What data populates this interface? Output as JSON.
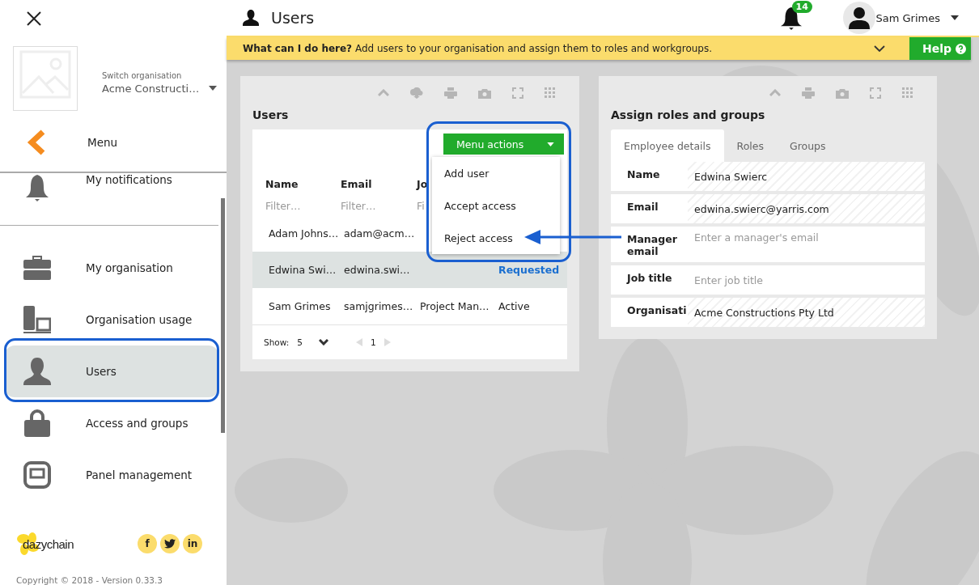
{
  "sidebar": {
    "org_switch": {
      "label": "Switch organisation",
      "value": "Acme Constructi…"
    },
    "menu_label": "Menu",
    "items": [
      {
        "label": "My notifications",
        "selected": false
      },
      {
        "label": "My organisation",
        "selected": false
      },
      {
        "label": "Organisation usage",
        "selected": false
      },
      {
        "label": "Users",
        "selected": true
      },
      {
        "label": "Access and groups",
        "selected": false
      },
      {
        "label": "Panel management",
        "selected": false
      }
    ],
    "brand": "dazychain",
    "social": [
      {
        "kind": "letter",
        "text": "f"
      },
      {
        "kind": "bird"
      },
      {
        "kind": "letter",
        "text": "in"
      }
    ],
    "copyright": "Copyright © 2018 - Version 0.33.3"
  },
  "header": {
    "title": "Users",
    "notifications": "14",
    "user": "Sam Grimes"
  },
  "help_bar": {
    "text": "**What can I do here?** Add users to your organisation and assign them to roles and workgroups.",
    "button": "Help"
  },
  "users_panel": {
    "title": "Users",
    "menu_button": "Menu actions",
    "menu_items": [
      "Add user",
      "Accept access",
      "Reject access"
    ],
    "columns": [
      {
        "label": "Name",
        "placeholder": "Filter…"
      },
      {
        "label": "Email",
        "placeholder": "Filter…"
      },
      {
        "label": "Jo",
        "placeholder": "Fi"
      }
    ],
    "rows": [
      {
        "cells": [
          "Adam Johns…",
          "adam@acm…"
        ],
        "selected": false
      },
      {
        "cells": [
          "Edwina Swi…",
          "edwina.swi…"
        ],
        "status": {
          "text": "Requested",
          "kind": "requested"
        },
        "selected": true
      },
      {
        "cells": [
          "Sam Grimes",
          "samjgrimes…",
          "Project Man…"
        ],
        "status": {
          "text": "Active",
          "kind": "plain"
        },
        "selected": false
      }
    ],
    "show_label": "Show:",
    "page_size": "5",
    "page": "1"
  },
  "assign_panel": {
    "title": "Assign roles and groups",
    "tabs": [
      {
        "label": "Employee details",
        "selected": true
      },
      {
        "label": "Roles",
        "selected": false
      },
      {
        "label": "Groups",
        "selected": false
      }
    ],
    "fields": [
      {
        "label": "Name",
        "kind": "readonly",
        "value": "Edwina Swierc"
      },
      {
        "label": "Email",
        "kind": "readonly",
        "value": "edwina.swierc@yarris.com"
      },
      {
        "label": "Manager email",
        "kind": "input",
        "placeholder": "Enter a manager's email"
      },
      {
        "label": "Job title",
        "kind": "input",
        "placeholder": "Enter job title"
      },
      {
        "label": "Organisati",
        "kind": "readonly",
        "value": "Acme Constructions Pty Ltd"
      }
    ]
  }
}
